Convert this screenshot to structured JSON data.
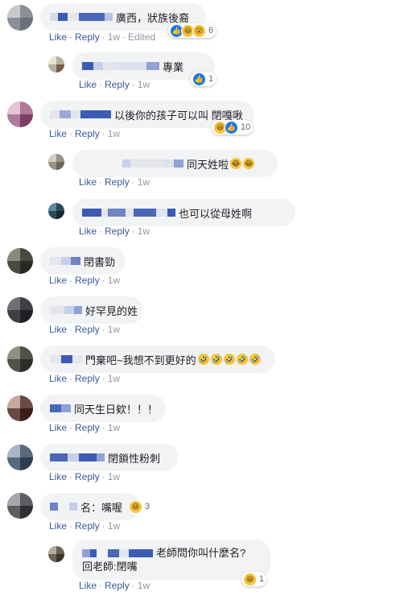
{
  "labels": {
    "like": "Like",
    "reply": "Reply",
    "edited": "Edited"
  },
  "colors": {
    "link": "#385898",
    "bubble": "#f2f3f5",
    "like_blue": "#1877f2",
    "emoji_yellow": "#f7c33b"
  },
  "comments": [
    {
      "text": "廣西，狀族後裔",
      "time": "1w",
      "edited": true,
      "reactions": [
        "like-icon",
        "haha-icon",
        "wow-icon"
      ],
      "count": "6"
    },
    {
      "text": "專業",
      "time": "1w",
      "reactions": [
        "like-icon"
      ],
      "count": "1"
    },
    {
      "text": "以後你的孩子可以叫 閉嘎啾",
      "time": "1w",
      "reactions": [
        "haha-icon",
        "like-icon"
      ],
      "count": "10"
    },
    {
      "text": "同天姓啦",
      "time": "1w",
      "emojis": [
        "haha-emoji",
        "haha-emoji"
      ]
    },
    {
      "text": "也可以從母姓啊",
      "time": "1w"
    },
    {
      "text": "閉書勁",
      "time": "1w"
    },
    {
      "text": "好罕見的姓",
      "time": "1w"
    },
    {
      "text": "門棄吧~我想不到更好的",
      "time": "1w",
      "emojis": [
        "rofl-emoji",
        "rofl-emoji",
        "rofl-emoji",
        "rofl-emoji",
        "rofl-emoji"
      ]
    },
    {
      "text": "同天生日欸！！！",
      "time": "1w"
    },
    {
      "text": "閉鎖性粉刺",
      "time": "1w"
    },
    {
      "text": "名：嘴喔",
      "time": "1w",
      "reactions": [
        "haha-icon"
      ],
      "count": "3"
    },
    {
      "text_line1": "老師問你叫什麼名?",
      "text_line2": "回老師:閉嘴",
      "time": "1w",
      "reactions": [
        "haha-icon"
      ],
      "count": "1"
    }
  ]
}
